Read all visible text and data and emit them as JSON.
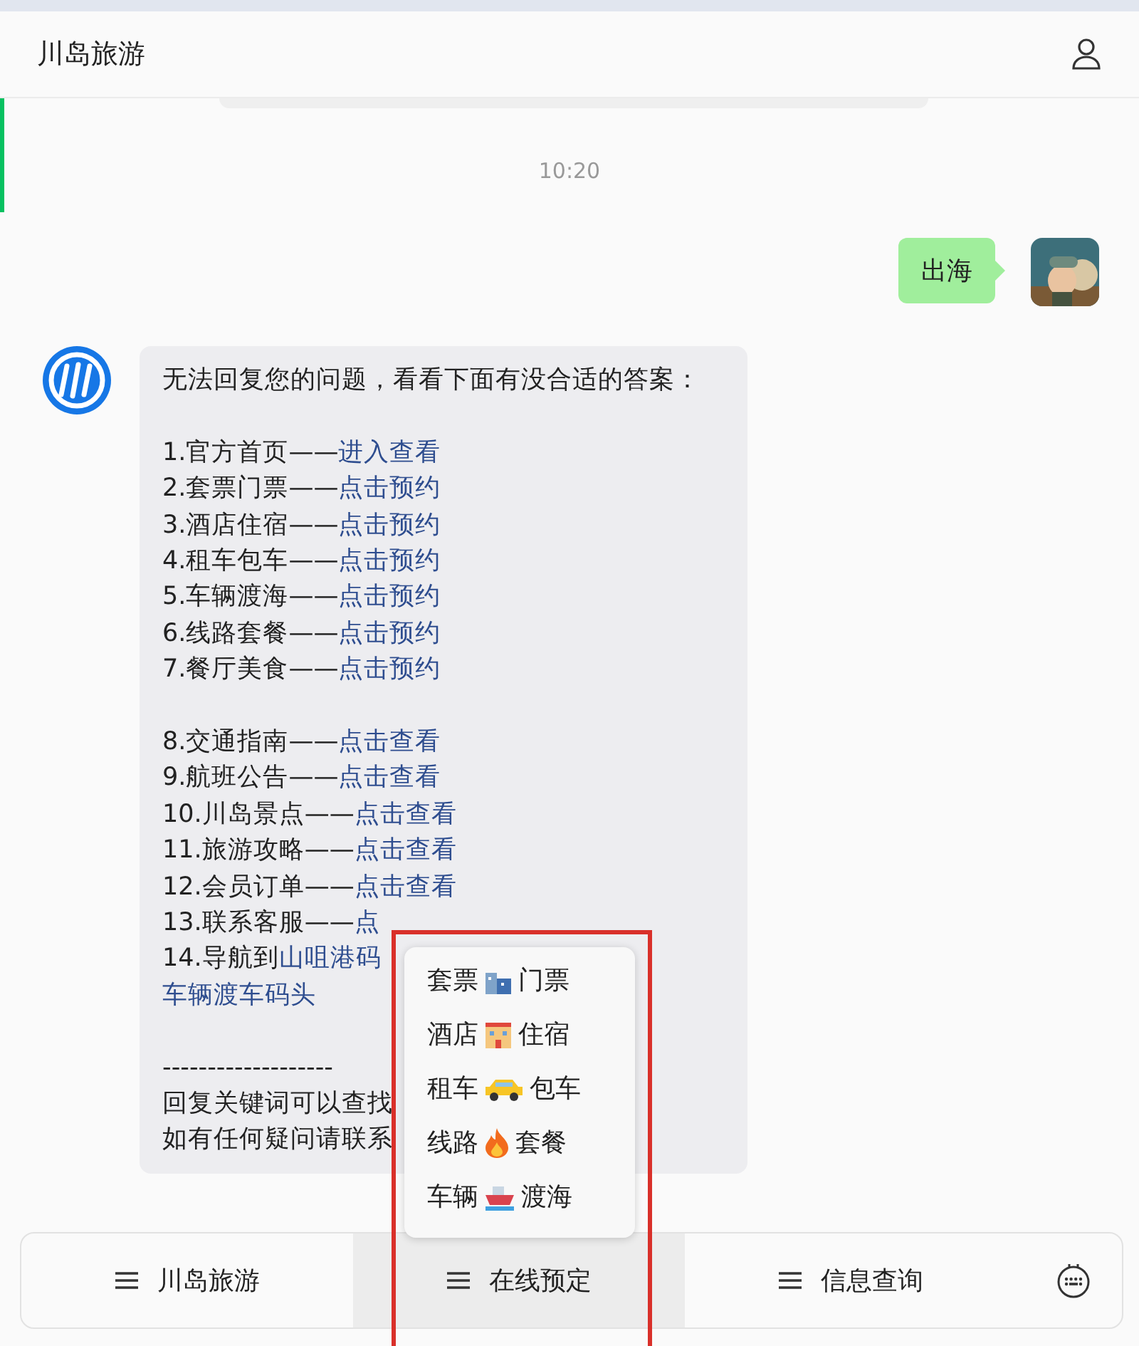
{
  "header": {
    "title": "川岛旅游"
  },
  "time_divider": "10:20",
  "user_message": {
    "text": "出海"
  },
  "bot_message": {
    "lines": [
      {
        "kind": "text",
        "text": "无法回复您的问题，看看下面有没合适的答案："
      },
      {
        "kind": "blank"
      },
      {
        "kind": "text",
        "text": "1.官方首页——",
        "link": "进入查看"
      },
      {
        "kind": "text",
        "text": "2.套票门票——",
        "link": "点击预约"
      },
      {
        "kind": "text",
        "text": "3.酒店住宿——",
        "link": "点击预约"
      },
      {
        "kind": "text",
        "text": "4.租车包车——",
        "link": "点击预约"
      },
      {
        "kind": "text",
        "text": "5.车辆渡海——",
        "link": "点击预约"
      },
      {
        "kind": "text",
        "text": "6.线路套餐——",
        "link": "点击预约"
      },
      {
        "kind": "text",
        "text": "7.餐厅美食——",
        "link": "点击预约"
      },
      {
        "kind": "blank"
      },
      {
        "kind": "text",
        "text": "8.交通指南——",
        "link": "点击查看"
      },
      {
        "kind": "text",
        "text": "9.航班公告——",
        "link": "点击查看"
      },
      {
        "kind": "text",
        "text": "10.川岛景点——",
        "link": "点击查看"
      },
      {
        "kind": "text",
        "text": "11.旅游攻略——",
        "link": "点击查看"
      },
      {
        "kind": "text",
        "text": "12.会员订单——",
        "link": "点击查看"
      },
      {
        "kind": "text",
        "text": "13.联系客服——",
        "link": "点"
      },
      {
        "kind": "text",
        "text": "14.导航到",
        "link": "山咀港码"
      },
      {
        "kind": "text",
        "link": "车辆渡车码头"
      },
      {
        "kind": "blank"
      },
      {
        "kind": "text",
        "text": "-------------------"
      },
      {
        "kind": "text",
        "text": "回复关键词可以查找"
      },
      {
        "kind": "text",
        "text": "如有任何疑问请联系"
      }
    ]
  },
  "popup_menu": [
    {
      "left": "套票",
      "right": "门票"
    },
    {
      "left": "酒店",
      "right": "住宿"
    },
    {
      "left": "租车",
      "right": "包车"
    },
    {
      "left": "线路",
      "right": "套餐"
    },
    {
      "left": "车辆",
      "right": "渡海"
    }
  ],
  "bottom_menu": [
    {
      "label": "川岛旅游",
      "selected": false
    },
    {
      "label": "在线预定",
      "selected": true
    },
    {
      "label": "信息查询",
      "selected": false
    }
  ]
}
